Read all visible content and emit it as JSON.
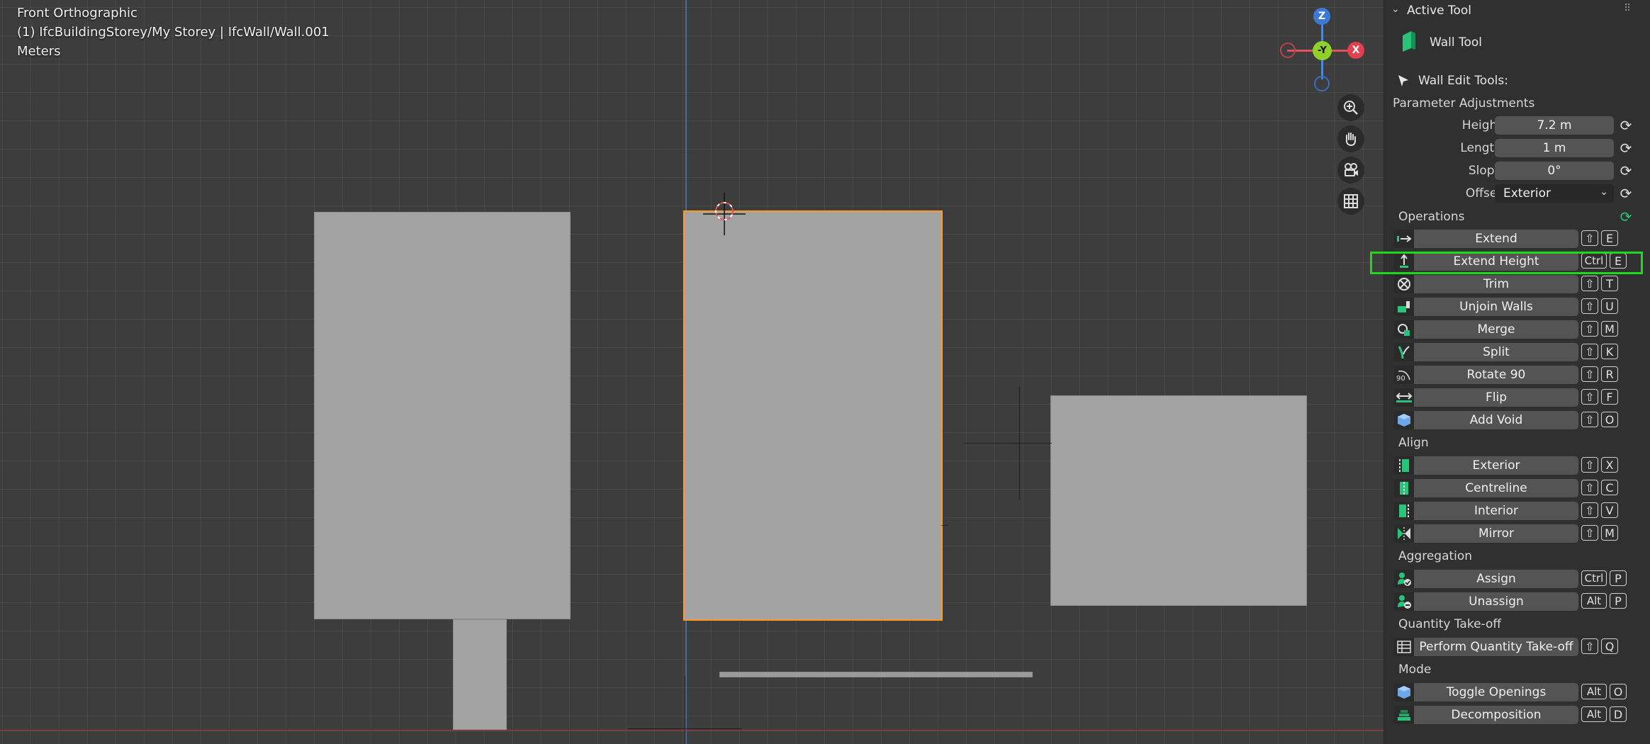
{
  "viewport": {
    "view_name": "Front Orthographic",
    "context": "(1) IfcBuildingStorey/My Storey | IfcWall/Wall.001",
    "units": "Meters",
    "gizmo": {
      "z": "Z",
      "y": "-Y",
      "x": "X"
    },
    "nav_icons": [
      "zoom-icon",
      "pan-hand-icon",
      "camera-icon",
      "grid-icon"
    ]
  },
  "sidebar": {
    "header": "Active Tool",
    "tool_name": "Wall Tool",
    "edit_tools_label": "Wall Edit Tools:",
    "param_section": "Parameter Adjustments",
    "params": [
      {
        "label": "Height",
        "value": "7.2 m"
      },
      {
        "label": "Length",
        "value": "1 m"
      },
      {
        "label": "Slope",
        "value": "0°"
      },
      {
        "label": "Offset",
        "value": "Exterior"
      }
    ],
    "sections": {
      "operations": "Operations",
      "align": "Align",
      "aggregation": "Aggregation",
      "qto": "Quantity Take-off",
      "mode": "Mode"
    },
    "operations": [
      {
        "label": "Extend",
        "mod": "⇧",
        "key": "E"
      },
      {
        "label": "Extend Height",
        "mod": "Ctrl",
        "key": "E"
      },
      {
        "label": "Trim",
        "mod": "⇧",
        "key": "T"
      },
      {
        "label": "Unjoin Walls",
        "mod": "⇧",
        "key": "U"
      },
      {
        "label": "Merge",
        "mod": "⇧",
        "key": "M"
      },
      {
        "label": "Split",
        "mod": "⇧",
        "key": "K"
      },
      {
        "label": "Rotate 90",
        "mod": "⇧",
        "key": "R"
      },
      {
        "label": "Flip",
        "mod": "⇧",
        "key": "F"
      },
      {
        "label": "Add Void",
        "mod": "⇧",
        "key": "O"
      }
    ],
    "align": [
      {
        "label": "Exterior",
        "mod": "⇧",
        "key": "X"
      },
      {
        "label": "Centreline",
        "mod": "⇧",
        "key": "C"
      },
      {
        "label": "Interior",
        "mod": "⇧",
        "key": "V"
      },
      {
        "label": "Mirror",
        "mod": "⇧",
        "key": "M"
      }
    ],
    "aggregation": [
      {
        "label": "Assign",
        "mod": "Ctrl",
        "key": "P"
      },
      {
        "label": "Unassign",
        "mod": "Alt",
        "key": "P"
      }
    ],
    "qto": [
      {
        "label": "Perform Quantity Take-off",
        "mod": "⇧",
        "key": "Q"
      }
    ],
    "mode": [
      {
        "label": "Toggle Openings",
        "mod": "Alt",
        "key": "O"
      },
      {
        "label": "Decomposition",
        "mod": "Alt",
        "key": "D"
      }
    ]
  },
  "colors": {
    "accent_green": "#1ed81e",
    "selection_orange": "#ff9a2b",
    "ifc_green": "#27c47a"
  }
}
